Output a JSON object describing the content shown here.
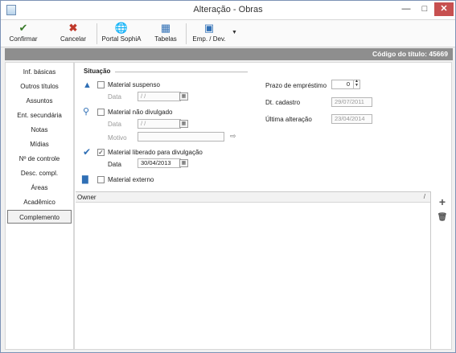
{
  "window": {
    "title": "Alteração - Obras"
  },
  "toolbar": {
    "buttons": [
      {
        "label": "Confirmar",
        "icon": "checkmark-icon"
      },
      {
        "label": "Cancelar",
        "icon": "x-icon"
      },
      {
        "label": "Portal SophiA",
        "icon": "globe-icon"
      },
      {
        "label": "Tabelas",
        "icon": "tables-icon"
      },
      {
        "label": "Emp. / Dev.",
        "icon": "loan-icon"
      }
    ]
  },
  "header": {
    "code_text": "Código do título: 45669"
  },
  "nav": {
    "items": [
      "Inf. básicas",
      "Outros títulos",
      "Assuntos",
      "Ent. secundária",
      "Notas",
      "Mídias",
      "Nº de controle",
      "Desc. compl.",
      "Áreas",
      "Acadêmico",
      "Complemento"
    ],
    "active": "Complemento"
  },
  "situacao": {
    "label": "Situação",
    "suspenso": {
      "label": "Material suspenso",
      "checked": false,
      "data_label": "Data",
      "data_value": " / /"
    },
    "nao_divulgado": {
      "label": "Material não divulgado",
      "checked": false,
      "data_label": "Data",
      "data_value": " / /",
      "motivo_label": "Motivo",
      "motivo_value": ""
    },
    "liberado": {
      "label": "Material liberado para divulgação",
      "checked": true,
      "data_label": "Data",
      "data_value": "30/04/2013"
    },
    "externo": {
      "label": "Material externo",
      "checked": false
    }
  },
  "info": {
    "prazo_label": "Prazo de empréstimo",
    "prazo_value": "0",
    "cadastro_label": "Dt. cadastro",
    "cadastro_value": "29/07/2011",
    "alteracao_label": "Última alteração",
    "alteracao_value": "23/04/2014"
  },
  "owner_list": {
    "column": "Owner",
    "rows": []
  },
  "colors": {
    "codebar_bg": "#8e8e8e",
    "close_btn": "#c75050",
    "icon_blue": "#2f6fb5"
  }
}
